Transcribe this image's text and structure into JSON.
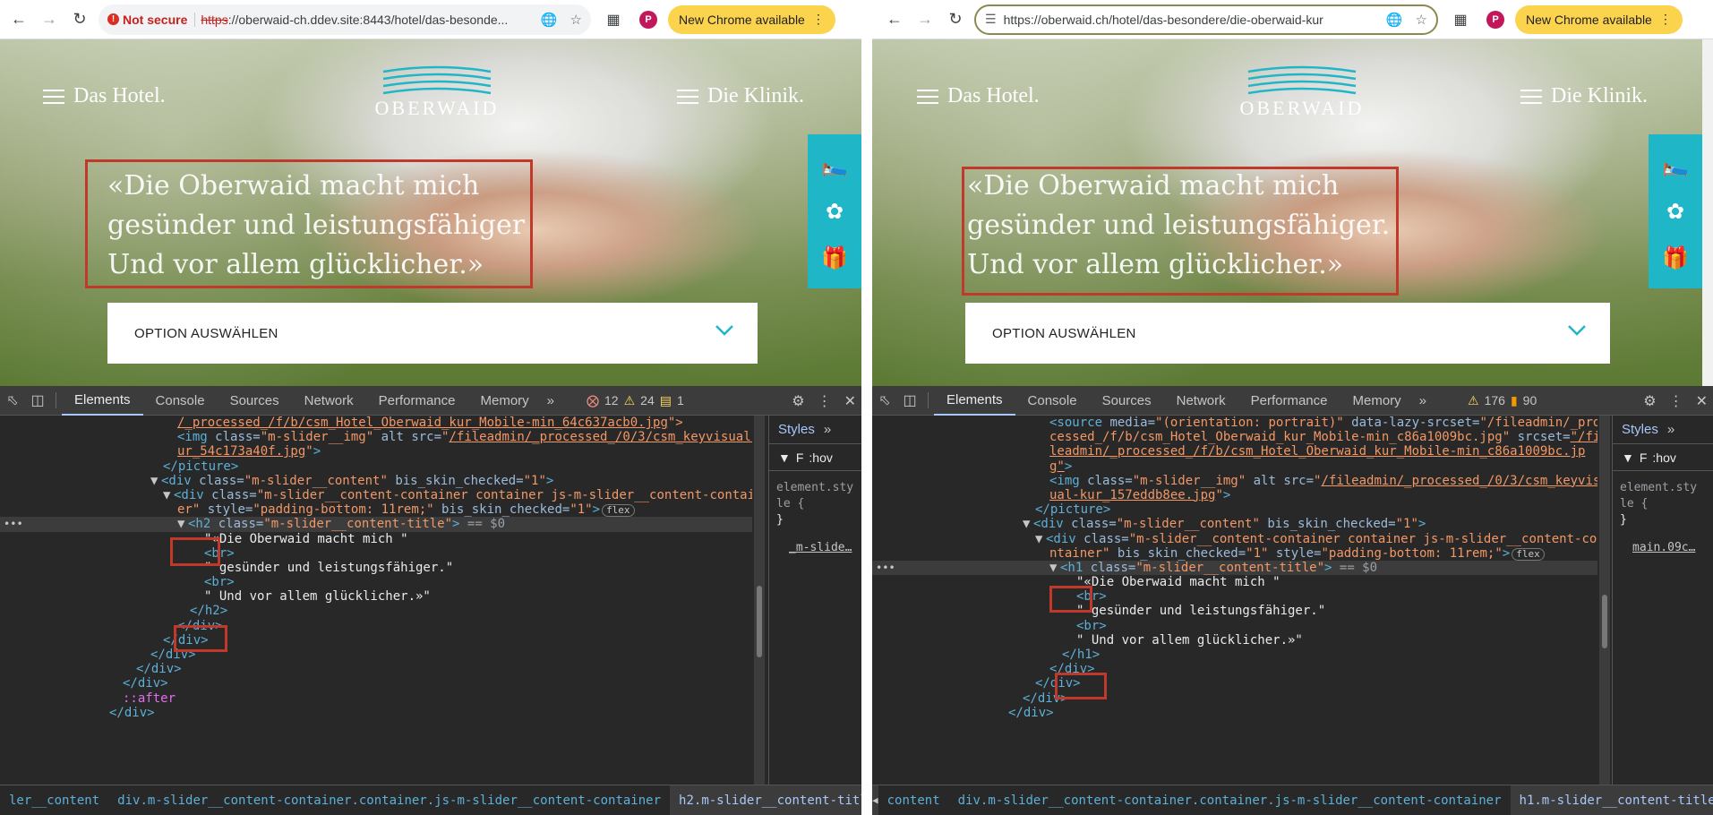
{
  "browser": {
    "new_chrome": "New Chrome available",
    "profile_initial": "P",
    "left_security": "Not secure",
    "left_url_scheme": "https",
    "left_url_rest": "://oberwaid-ch.ddev.site:8443/hotel/das-besonde...",
    "right_url": "https://oberwaid.ch/hotel/das-besondere/die-oberwaid-kur"
  },
  "site": {
    "nav_left": "Das Hotel.",
    "nav_right": "Die Klinik.",
    "logo_text": "OBERWAID",
    "hero_line1": "«Die Oberwaid macht mich",
    "hero_line2_left": "gesünder und leistungsfähiger",
    "hero_line2_right": "gesünder und leistungsfähiger.",
    "hero_line3": "Und vor allem glücklicher.»",
    "option_label": "OPTION AUSWÄHLEN",
    "colors": {
      "accent": "#1fb6c8",
      "highlight_box": "#c0392b"
    }
  },
  "devtools": {
    "tabs": [
      "Elements",
      "Console",
      "Sources",
      "Network",
      "Performance",
      "Memory"
    ],
    "left_errors": "12",
    "left_warnings": "24",
    "left_issues": "1",
    "right_warnings": "176",
    "right_issues": "90",
    "styles_tab": "Styles",
    "filter_hov": ":hov",
    "element_style": "element.style {",
    "element_style_wrapped1": "element.sty",
    "element_style_wrapped2": "le {",
    "close_brace": "}",
    "left_style_link": "_m-slide…",
    "right_style_link": "main.09c…",
    "filter_label": "F",
    "left_code": {
      "l1_val": "/_processed_/f/b/csm_Hotel_Oberwaid_kur_Mobile-min_64c637acb0.jpg",
      "l2_src": "/fileadmin/_processed_/0/3/csm_keyvisual-kur_54c173a40f.jpg",
      "l2_src_wrap": "ur_54c173a40f.jpg",
      "l3": "</picture>",
      "l4_class": "\"m-slider__content\"",
      "l4_bis": "\"1\"",
      "l5_class": "\"m-slider__content-container container js-m-slider__content-contain",
      "l5_wrap": "er\"",
      "l5_style": "\"padding-bottom: 11rem;\"",
      "l6_tag": "<h2",
      "l6_class": "\"m-slider__content-title\"",
      "l6_eq": " == $0",
      "t1": "\"«Die Oberwaid macht mich \"",
      "br": "<br>",
      "t2": "\" gesünder und leistungsfähiger.\"",
      "t3": "\" Und vor allem glücklicher.»\"",
      "close_h": "</h2>",
      "close_div": "</div>",
      "after": "::after"
    },
    "right_code": {
      "l1_media": "\"(orientation: portrait)\"",
      "l1_lazy": "\"/fileadmin/_pro",
      "l1_lazy2": "cessed_/f/b/csm_Hotel_Oberwaid_kur_Mobile-min_c86a1009bc.jpg\"",
      "l1_srcset": "\"/fi",
      "l1_srcset2": "leadmin/_processed_/f/b/csm_Hotel_Oberwaid_kur_Mobile-min_c86a1009bc.jp",
      "l1_srcset3": "g\"",
      "l2_src": "/fileadmin/_processed_/0/3/csm_keyvis",
      "l2_src2": "ual-kur_157eddb8ee.jpg",
      "l3": "</picture>",
      "l4_class": "\"m-slider__content\"",
      "l4_bis": "\"1\"",
      "l5_class": "\"m-slider__content-container container js-m-slider__content-co",
      "l5_wrap": "ntainer\"",
      "l5_bis": "\"1\"",
      "l5_style": "\"padding-bottom: 11rem;\"",
      "l6_tag": "<h1",
      "l6_class": "\"m-slider__content-title\"",
      "l6_eq": " == $0",
      "t1": "\"«Die Oberwaid macht mich \"",
      "br": "<br>",
      "t2": "\" gesünder und leistungsfähiger.\"",
      "t3": "\" Und vor allem glücklicher.»\"",
      "close_h": "</h1>",
      "close_div": "</div>"
    },
    "left_crumbs": [
      "ler__content",
      "div.m-slider__content-container.container.js-m-slider__content-container",
      "h2.m-slider__content-title"
    ],
    "right_crumbs": [
      "content",
      "div.m-slider__content-container.container.js-m-slider__content-container",
      "h1.m-slider__content-title"
    ]
  }
}
